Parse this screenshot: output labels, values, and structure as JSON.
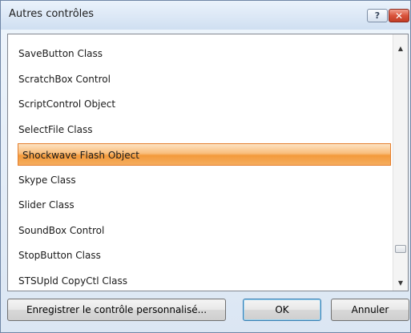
{
  "window": {
    "title": "Autres contrôles",
    "help_glyph": "?",
    "close_glyph": "✕"
  },
  "list": {
    "items": [
      {
        "label": "SaveButton Class",
        "selected": false
      },
      {
        "label": "ScratchBox Control",
        "selected": false
      },
      {
        "label": "ScriptControl Object",
        "selected": false
      },
      {
        "label": "SelectFile Class",
        "selected": false
      },
      {
        "label": "Shockwave Flash Object",
        "selected": true
      },
      {
        "label": "Skype Class",
        "selected": false
      },
      {
        "label": "Slider Class",
        "selected": false
      },
      {
        "label": "SoundBox Control",
        "selected": false
      },
      {
        "label": "StopButton Class",
        "selected": false
      },
      {
        "label": "STSUpld CopyCtl Class",
        "selected": false
      }
    ],
    "scroll_up_glyph": "▲",
    "scroll_down_glyph": "▼"
  },
  "buttons": {
    "register_label": "Enregistrer le contrôle personnalisé...",
    "ok_label": "OK",
    "cancel_label": "Annuler"
  },
  "colors": {
    "selection_accent": "#f39a3b",
    "close_button": "#c13d25",
    "title_bar": "#dce8f6"
  }
}
